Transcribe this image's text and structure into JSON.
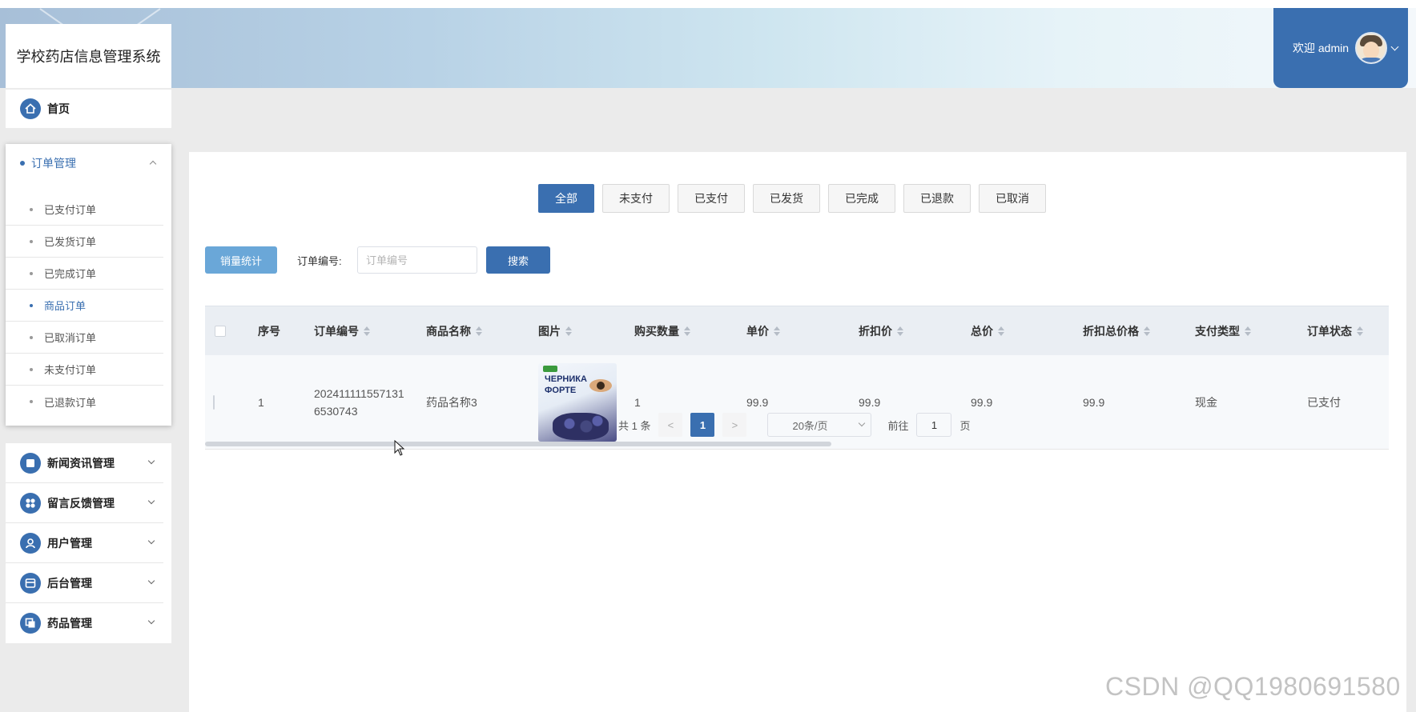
{
  "app": {
    "title": "学校药店信息管理系统",
    "welcome": "欢迎 admin"
  },
  "colors": {
    "primary": "#3a6fb0",
    "stats_button": "#6aa7d8"
  },
  "sidebar": {
    "home_label": "首页",
    "order_group": {
      "label": "订单管理",
      "items": [
        {
          "label": "已支付订单",
          "active": false
        },
        {
          "label": "已发货订单",
          "active": false
        },
        {
          "label": "已完成订单",
          "active": false
        },
        {
          "label": "商品订单",
          "active": true
        },
        {
          "label": "已取消订单",
          "active": false
        },
        {
          "label": "未支付订单",
          "active": false
        },
        {
          "label": "已退款订单",
          "active": false
        }
      ]
    },
    "menus": [
      {
        "label": "新闻资讯管理",
        "icon": "news-icon"
      },
      {
        "label": "留言反馈管理",
        "icon": "feedback-icon"
      },
      {
        "label": "用户管理",
        "icon": "user-icon"
      },
      {
        "label": "后台管理",
        "icon": "backend-icon"
      },
      {
        "label": "药品管理",
        "icon": "medicine-icon"
      }
    ]
  },
  "tabs": [
    "全部",
    "未支付",
    "已支付",
    "已发货",
    "已完成",
    "已退款",
    "已取消"
  ],
  "toolbar": {
    "stats_label": "销量统计",
    "search_label": "订单编号:",
    "search_placeholder": "订单编号",
    "search_button": "搜索"
  },
  "table": {
    "columns": [
      "序号",
      "订单编号",
      "商品名称",
      "图片",
      "购买数量",
      "单价",
      "折扣价",
      "总价",
      "折扣总价格",
      "支付类型",
      "订单状态"
    ],
    "rows": [
      {
        "index": "1",
        "order_no": "2024111115571316530743",
        "product": "药品名称3",
        "image_text_1": "ЧЕРНИКА",
        "image_text_2": "ФОРТЕ",
        "quantity": "1",
        "unit_price": "99.9",
        "discount_price": "99.9",
        "total": "99.9",
        "discount_total": "99.9",
        "pay_type": "现金",
        "status": "已支付"
      }
    ]
  },
  "pagination": {
    "total_text": "共 1 条",
    "prev": "<",
    "current": "1",
    "next": ">",
    "page_size": "20条/页",
    "goto_label": "前往",
    "goto_value": "1",
    "page_suffix": "页"
  },
  "watermark": "CSDN @QQ1980691580"
}
